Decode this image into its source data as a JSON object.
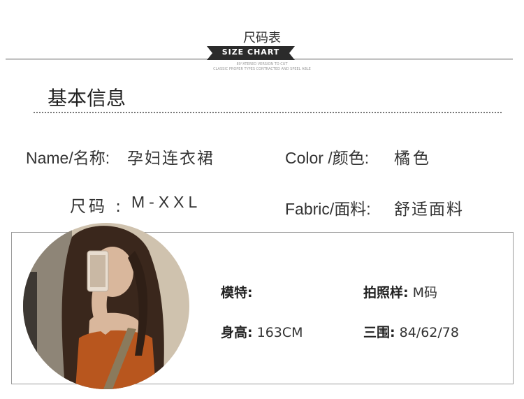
{
  "header": {
    "title_cn": "尺码表",
    "banner": "SIZE CHART",
    "fine_print_1": "80°ATEREO VERSION TO CUT",
    "fine_print_2": "CLASSIC PROPER TYPES CONTRACTED AND SPEEL ABLE"
  },
  "section": {
    "title": "基本信息"
  },
  "info": {
    "name_label": "Name/名称:",
    "name_value": "孕妇连衣裙",
    "color_label": "Color /颜色:",
    "color_value": "橘色",
    "size_label": "尺码 :",
    "size_value": "M-XXL",
    "fabric_label": "Fabric/面料:",
    "fabric_value": "舒适面料"
  },
  "model": {
    "model_label": "模特:",
    "model_value": "",
    "shoot_label": "拍照样:",
    "shoot_value": "M码",
    "height_label": "身高:",
    "height_value": "163CM",
    "bust_label": "三围:",
    "bust_value": "84/62/78"
  },
  "colors": {
    "banner_bg": "#2b2b2b",
    "rule": "#555555",
    "card_border": "#9a9a9a",
    "top_orange": "#b8561e",
    "hair_brown": "#3a271c",
    "wall_beige": "#cfc2ae"
  }
}
